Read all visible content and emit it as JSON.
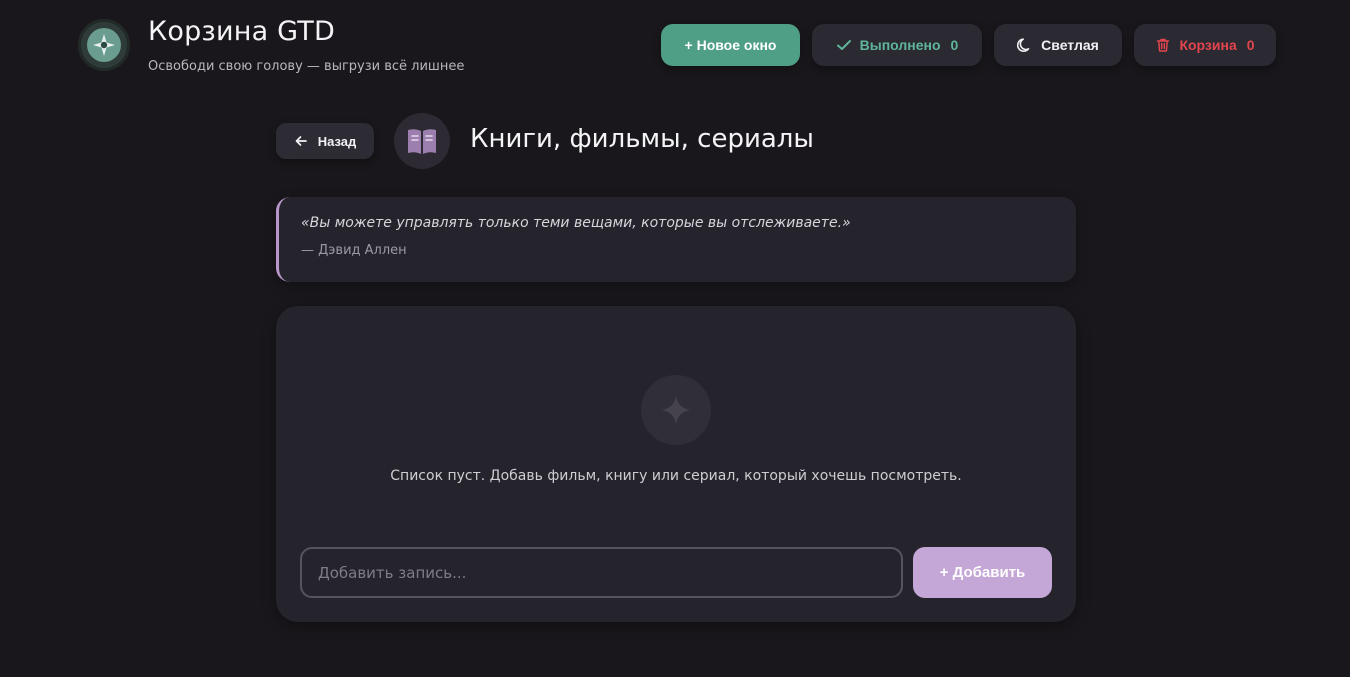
{
  "header": {
    "title": "Корзина GTD",
    "subtitle": "Освободи свою голову — выгрузи всё лишнее",
    "new_window_label": "+ Новое окно",
    "done_label": "Выполнено",
    "done_count": "0",
    "theme_label": "Светлая",
    "trash_label": "Корзина",
    "trash_count": "0"
  },
  "page": {
    "back_label": "Назад",
    "title": "Книги, фильмы, сериалы",
    "category_icon": "open-book-icon"
  },
  "quote": {
    "text": "«Вы можете управлять только теми вещами, которые вы отслеживаете.»",
    "author": "— Дэвид Аллен"
  },
  "list": {
    "empty_text": "Список пуст. Добавь фильм, книгу или сериал, который хочешь посмотреть.",
    "input_value": "",
    "input_placeholder": "Добавить запись...",
    "add_label": "+ Добавить"
  },
  "colors": {
    "background": "#19171b",
    "card": "#25242c",
    "accent_green": "#4f9e86",
    "done_green": "#5fb59b",
    "trash_red": "#e2454d",
    "accent_purple": "#c5a7d7"
  }
}
